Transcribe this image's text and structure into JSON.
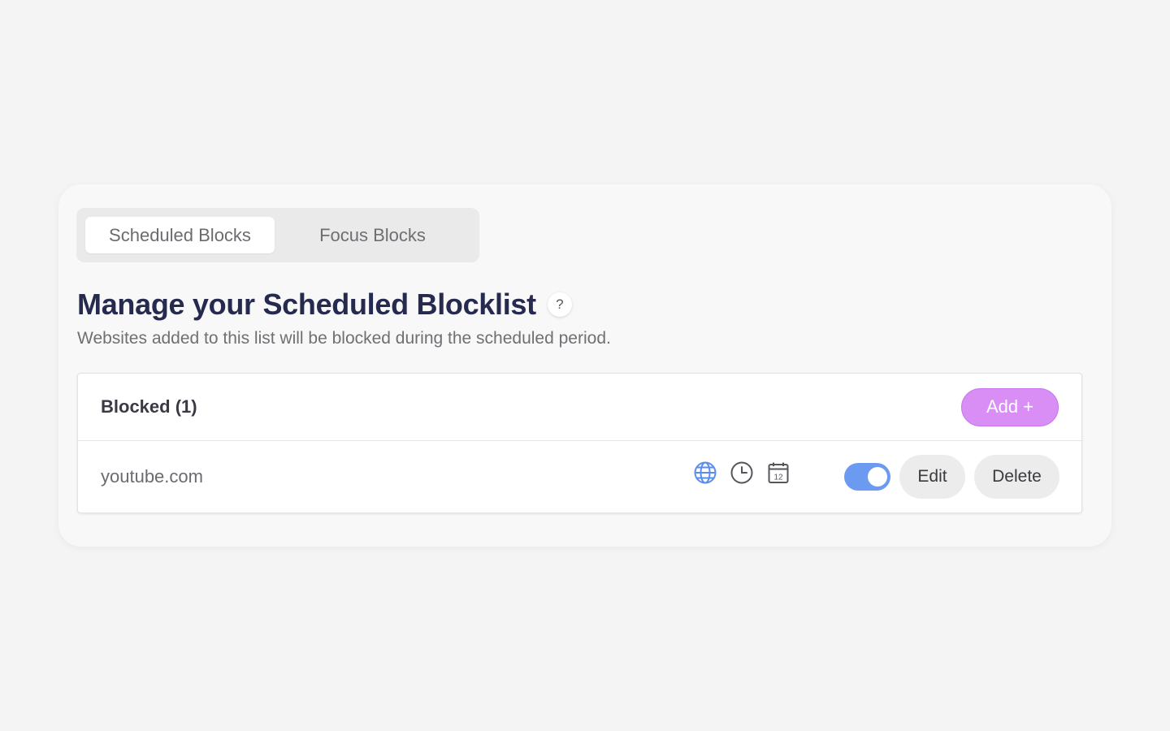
{
  "tabs": [
    {
      "label": "Scheduled Blocks",
      "active": true
    },
    {
      "label": "Focus Blocks",
      "active": false
    }
  ],
  "heading": {
    "title": "Manage your Scheduled Blocklist",
    "help_label": "?",
    "subtitle": "Websites added to this list will be blocked during the scheduled period."
  },
  "blocklist": {
    "title": "Blocked (1)",
    "add_label": "Add +",
    "items": [
      {
        "site": "youtube.com",
        "icons": [
          "globe-icon",
          "clock-icon",
          "calendar-icon"
        ],
        "calendar_day": "12",
        "enabled": true,
        "edit_label": "Edit",
        "delete_label": "Delete"
      }
    ]
  },
  "colors": {
    "accent_add": "#d98ef5",
    "toggle_on": "#6b9af0",
    "title": "#262a4f",
    "globe": "#5b8def"
  }
}
